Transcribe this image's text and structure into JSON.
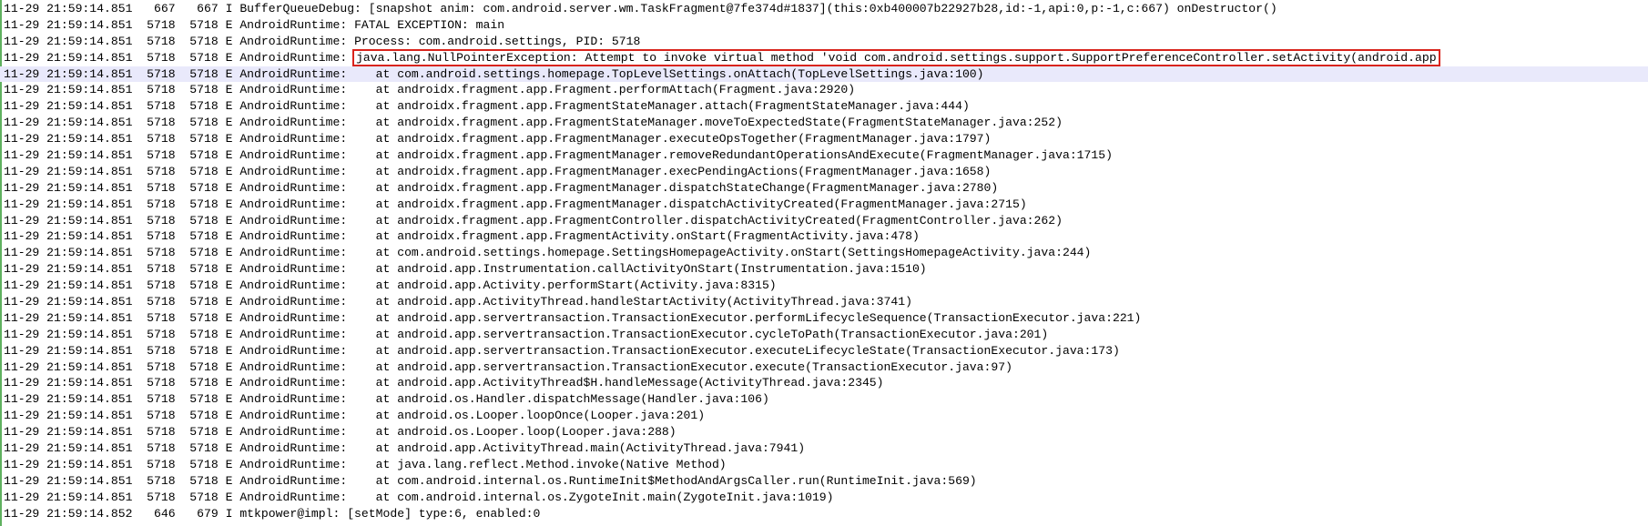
{
  "colors": {
    "background": "#ffffff",
    "gutter_bar": "#5fb05f",
    "highlight_row": "#e9e9fb",
    "box_outline": "#d9241c"
  },
  "log": {
    "lines": [
      {
        "time": "11-29 21:59:14.851",
        "pid": "667",
        "tid": "667",
        "level": "I",
        "tag": "BufferQueueDebug:",
        "message": "[snapshot anim: com.android.server.wm.TaskFragment@7fe374d#1837](this:0xb400007b22927b28,id:-1,api:0,p:-1,c:667) onDestructor()"
      },
      {
        "time": "11-29 21:59:14.851",
        "pid": "5718",
        "tid": "5718",
        "level": "E",
        "tag": "AndroidRuntime:",
        "message": "FATAL EXCEPTION: main"
      },
      {
        "time": "11-29 21:59:14.851",
        "pid": "5718",
        "tid": "5718",
        "level": "E",
        "tag": "AndroidRuntime:",
        "message": "Process: com.android.settings, PID: 5718"
      },
      {
        "time": "11-29 21:59:14.851",
        "pid": "5718",
        "tid": "5718",
        "level": "E",
        "tag": "AndroidRuntime:",
        "message": "java.lang.NullPointerException: Attempt to invoke virtual method 'void com.android.settings.support.SupportPreferenceController.setActivity(android.app",
        "boxed": true
      },
      {
        "time": "11-29 21:59:14.851",
        "pid": "5718",
        "tid": "5718",
        "level": "E",
        "tag": "AndroidRuntime:",
        "message": "   at com.android.settings.homepage.TopLevelSettings.onAttach(TopLevelSettings.java:100)",
        "highlighted": true
      },
      {
        "time": "11-29 21:59:14.851",
        "pid": "5718",
        "tid": "5718",
        "level": "E",
        "tag": "AndroidRuntime:",
        "message": "   at androidx.fragment.app.Fragment.performAttach(Fragment.java:2920)"
      },
      {
        "time": "11-29 21:59:14.851",
        "pid": "5718",
        "tid": "5718",
        "level": "E",
        "tag": "AndroidRuntime:",
        "message": "   at androidx.fragment.app.FragmentStateManager.attach(FragmentStateManager.java:444)"
      },
      {
        "time": "11-29 21:59:14.851",
        "pid": "5718",
        "tid": "5718",
        "level": "E",
        "tag": "AndroidRuntime:",
        "message": "   at androidx.fragment.app.FragmentStateManager.moveToExpectedState(FragmentStateManager.java:252)"
      },
      {
        "time": "11-29 21:59:14.851",
        "pid": "5718",
        "tid": "5718",
        "level": "E",
        "tag": "AndroidRuntime:",
        "message": "   at androidx.fragment.app.FragmentManager.executeOpsTogether(FragmentManager.java:1797)"
      },
      {
        "time": "11-29 21:59:14.851",
        "pid": "5718",
        "tid": "5718",
        "level": "E",
        "tag": "AndroidRuntime:",
        "message": "   at androidx.fragment.app.FragmentManager.removeRedundantOperationsAndExecute(FragmentManager.java:1715)"
      },
      {
        "time": "11-29 21:59:14.851",
        "pid": "5718",
        "tid": "5718",
        "level": "E",
        "tag": "AndroidRuntime:",
        "message": "   at androidx.fragment.app.FragmentManager.execPendingActions(FragmentManager.java:1658)"
      },
      {
        "time": "11-29 21:59:14.851",
        "pid": "5718",
        "tid": "5718",
        "level": "E",
        "tag": "AndroidRuntime:",
        "message": "   at androidx.fragment.app.FragmentManager.dispatchStateChange(FragmentManager.java:2780)"
      },
      {
        "time": "11-29 21:59:14.851",
        "pid": "5718",
        "tid": "5718",
        "level": "E",
        "tag": "AndroidRuntime:",
        "message": "   at androidx.fragment.app.FragmentManager.dispatchActivityCreated(FragmentManager.java:2715)"
      },
      {
        "time": "11-29 21:59:14.851",
        "pid": "5718",
        "tid": "5718",
        "level": "E",
        "tag": "AndroidRuntime:",
        "message": "   at androidx.fragment.app.FragmentController.dispatchActivityCreated(FragmentController.java:262)"
      },
      {
        "time": "11-29 21:59:14.851",
        "pid": "5718",
        "tid": "5718",
        "level": "E",
        "tag": "AndroidRuntime:",
        "message": "   at androidx.fragment.app.FragmentActivity.onStart(FragmentActivity.java:478)"
      },
      {
        "time": "11-29 21:59:14.851",
        "pid": "5718",
        "tid": "5718",
        "level": "E",
        "tag": "AndroidRuntime:",
        "message": "   at com.android.settings.homepage.SettingsHomepageActivity.onStart(SettingsHomepageActivity.java:244)"
      },
      {
        "time": "11-29 21:59:14.851",
        "pid": "5718",
        "tid": "5718",
        "level": "E",
        "tag": "AndroidRuntime:",
        "message": "   at android.app.Instrumentation.callActivityOnStart(Instrumentation.java:1510)"
      },
      {
        "time": "11-29 21:59:14.851",
        "pid": "5718",
        "tid": "5718",
        "level": "E",
        "tag": "AndroidRuntime:",
        "message": "   at android.app.Activity.performStart(Activity.java:8315)"
      },
      {
        "time": "11-29 21:59:14.851",
        "pid": "5718",
        "tid": "5718",
        "level": "E",
        "tag": "AndroidRuntime:",
        "message": "   at android.app.ActivityThread.handleStartActivity(ActivityThread.java:3741)"
      },
      {
        "time": "11-29 21:59:14.851",
        "pid": "5718",
        "tid": "5718",
        "level": "E",
        "tag": "AndroidRuntime:",
        "message": "   at android.app.servertransaction.TransactionExecutor.performLifecycleSequence(TransactionExecutor.java:221)"
      },
      {
        "time": "11-29 21:59:14.851",
        "pid": "5718",
        "tid": "5718",
        "level": "E",
        "tag": "AndroidRuntime:",
        "message": "   at android.app.servertransaction.TransactionExecutor.cycleToPath(TransactionExecutor.java:201)"
      },
      {
        "time": "11-29 21:59:14.851",
        "pid": "5718",
        "tid": "5718",
        "level": "E",
        "tag": "AndroidRuntime:",
        "message": "   at android.app.servertransaction.TransactionExecutor.executeLifecycleState(TransactionExecutor.java:173)"
      },
      {
        "time": "11-29 21:59:14.851",
        "pid": "5718",
        "tid": "5718",
        "level": "E",
        "tag": "AndroidRuntime:",
        "message": "   at android.app.servertransaction.TransactionExecutor.execute(TransactionExecutor.java:97)"
      },
      {
        "time": "11-29 21:59:14.851",
        "pid": "5718",
        "tid": "5718",
        "level": "E",
        "tag": "AndroidRuntime:",
        "message": "   at android.app.ActivityThread$H.handleMessage(ActivityThread.java:2345)"
      },
      {
        "time": "11-29 21:59:14.851",
        "pid": "5718",
        "tid": "5718",
        "level": "E",
        "tag": "AndroidRuntime:",
        "message": "   at android.os.Handler.dispatchMessage(Handler.java:106)"
      },
      {
        "time": "11-29 21:59:14.851",
        "pid": "5718",
        "tid": "5718",
        "level": "E",
        "tag": "AndroidRuntime:",
        "message": "   at android.os.Looper.loopOnce(Looper.java:201)"
      },
      {
        "time": "11-29 21:59:14.851",
        "pid": "5718",
        "tid": "5718",
        "level": "E",
        "tag": "AndroidRuntime:",
        "message": "   at android.os.Looper.loop(Looper.java:288)"
      },
      {
        "time": "11-29 21:59:14.851",
        "pid": "5718",
        "tid": "5718",
        "level": "E",
        "tag": "AndroidRuntime:",
        "message": "   at android.app.ActivityThread.main(ActivityThread.java:7941)"
      },
      {
        "time": "11-29 21:59:14.851",
        "pid": "5718",
        "tid": "5718",
        "level": "E",
        "tag": "AndroidRuntime:",
        "message": "   at java.lang.reflect.Method.invoke(Native Method)"
      },
      {
        "time": "11-29 21:59:14.851",
        "pid": "5718",
        "tid": "5718",
        "level": "E",
        "tag": "AndroidRuntime:",
        "message": "   at com.android.internal.os.RuntimeInit$MethodAndArgsCaller.run(RuntimeInit.java:569)"
      },
      {
        "time": "11-29 21:59:14.851",
        "pid": "5718",
        "tid": "5718",
        "level": "E",
        "tag": "AndroidRuntime:",
        "message": "   at com.android.internal.os.ZygoteInit.main(ZygoteInit.java:1019)"
      },
      {
        "time": "11-29 21:59:14.852",
        "pid": "646",
        "tid": "679",
        "level": "I",
        "tag": "mtkpower@impl:",
        "message": "[setMode] type:6, enabled:0"
      }
    ]
  }
}
